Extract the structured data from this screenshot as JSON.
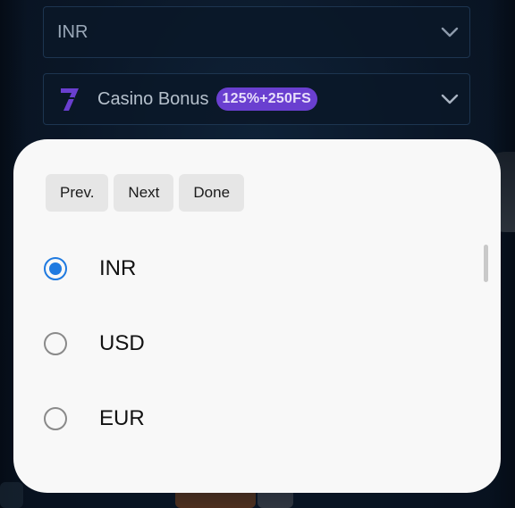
{
  "background": {
    "currency_select": {
      "value": "INR",
      "icon": "chevron-down-icon"
    },
    "bonus_select": {
      "logo": "seven-logo-icon",
      "label": "Casino Bonus",
      "badge": "125%+250FS",
      "icon": "chevron-down-icon"
    }
  },
  "picker": {
    "nav": {
      "prev_label": "Prev.",
      "next_label": "Next",
      "done_label": "Done"
    },
    "options": [
      {
        "label": "INR",
        "selected": true
      },
      {
        "label": "USD",
        "selected": false
      },
      {
        "label": "EUR",
        "selected": false
      }
    ]
  },
  "colors": {
    "accent": "#1f7ae0",
    "badge": "#6a3fd0",
    "background": "#0a1626",
    "sheet": "#f8f8f8"
  }
}
